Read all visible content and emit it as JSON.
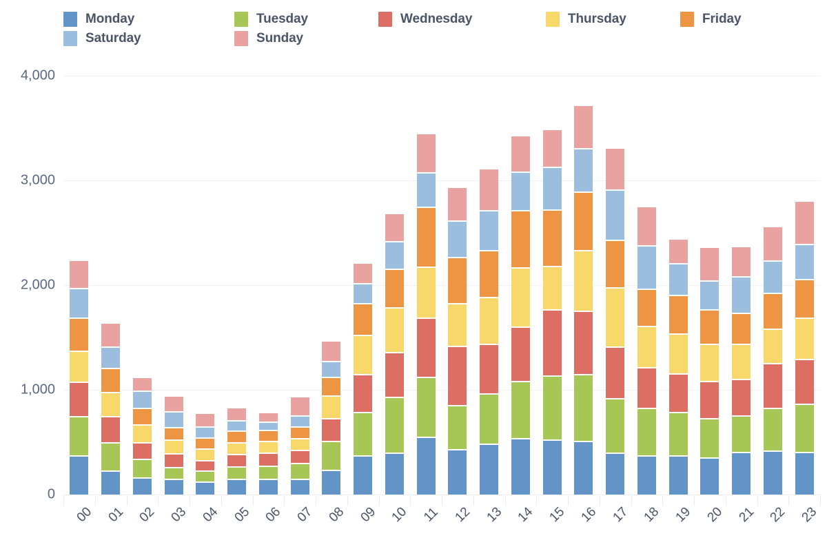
{
  "legend": {
    "position": "top-left",
    "items": [
      {
        "label": "Monday",
        "color": "#6394c8",
        "icon": "legend-swatch-icon"
      },
      {
        "label": "Tuesday",
        "color": "#a6c656",
        "icon": "legend-swatch-icon"
      },
      {
        "label": "Wednesday",
        "color": "#dd6e63",
        "icon": "legend-swatch-icon"
      },
      {
        "label": "Thursday",
        "color": "#f8d86a",
        "icon": "legend-swatch-icon"
      },
      {
        "label": "Friday",
        "color": "#ee9543",
        "icon": "legend-swatch-icon"
      },
      {
        "label": "Saturday",
        "color": "#9bbdde",
        "icon": "legend-swatch-icon"
      },
      {
        "label": "Sunday",
        "color": "#e9a29f",
        "icon": "legend-swatch-icon"
      }
    ]
  },
  "yaxis": {
    "ticks": [
      "0",
      "1,000",
      "2,000",
      "3,000",
      "4,000"
    ],
    "values": [
      0,
      1000,
      2000,
      3000,
      4000
    ],
    "min": 0,
    "max": 4000
  },
  "chart_data": {
    "type": "bar",
    "stacked": true,
    "title": "",
    "subtitle": "",
    "xlabel": "",
    "ylabel": "",
    "ylim": [
      0,
      4000
    ],
    "grid": true,
    "legend_position": "top-left",
    "categories": [
      "00",
      "01",
      "02",
      "03",
      "04",
      "05",
      "06",
      "07",
      "08",
      "09",
      "10",
      "11",
      "12",
      "13",
      "14",
      "15",
      "16",
      "17",
      "18",
      "19",
      "20",
      "21",
      "22",
      "23"
    ],
    "series": [
      {
        "name": "Monday",
        "color": "#6394c8",
        "values": [
          360,
          220,
          150,
          140,
          110,
          135,
          140,
          135,
          225,
          360,
          390,
          540,
          420,
          475,
          525,
          510,
          500,
          390,
          360,
          365,
          345,
          395,
          410,
          395
        ]
      },
      {
        "name": "Tuesday",
        "color": "#a6c656",
        "values": [
          380,
          265,
          180,
          110,
          110,
          120,
          125,
          155,
          275,
          415,
          530,
          570,
          420,
          480,
          550,
          615,
          635,
          520,
          455,
          410,
          370,
          350,
          405,
          460
        ]
      },
      {
        "name": "Wednesday",
        "color": "#dd6e63",
        "values": [
          325,
          250,
          160,
          130,
          95,
          120,
          125,
          125,
          215,
          360,
          430,
          565,
          565,
          470,
          520,
          635,
          610,
          490,
          390,
          370,
          355,
          350,
          430,
          425
        ]
      },
      {
        "name": "Thursday",
        "color": "#f8d86a",
        "values": [
          300,
          235,
          165,
          135,
          110,
          115,
          110,
          110,
          220,
          380,
          425,
          490,
          410,
          450,
          565,
          410,
          575,
          570,
          395,
          380,
          355,
          330,
          330,
          400
        ]
      },
      {
        "name": "Friday",
        "color": "#ee9543",
        "values": [
          310,
          230,
          160,
          120,
          105,
          110,
          105,
          115,
          180,
          300,
          370,
          570,
          440,
          445,
          545,
          540,
          565,
          450,
          355,
          370,
          330,
          300,
          340,
          365
        ]
      },
      {
        "name": "Saturday",
        "color": "#9bbdde",
        "values": [
          285,
          200,
          165,
          145,
          110,
          100,
          80,
          105,
          150,
          195,
          265,
          330,
          350,
          385,
          370,
          410,
          410,
          485,
          415,
          300,
          275,
          350,
          310,
          340
        ]
      },
      {
        "name": "Sunday",
        "color": "#e9a29f",
        "values": [
          270,
          230,
          135,
          155,
          130,
          125,
          90,
          185,
          195,
          195,
          265,
          375,
          320,
          400,
          345,
          360,
          415,
          400,
          375,
          240,
          325,
          290,
          330,
          410
        ]
      }
    ]
  }
}
